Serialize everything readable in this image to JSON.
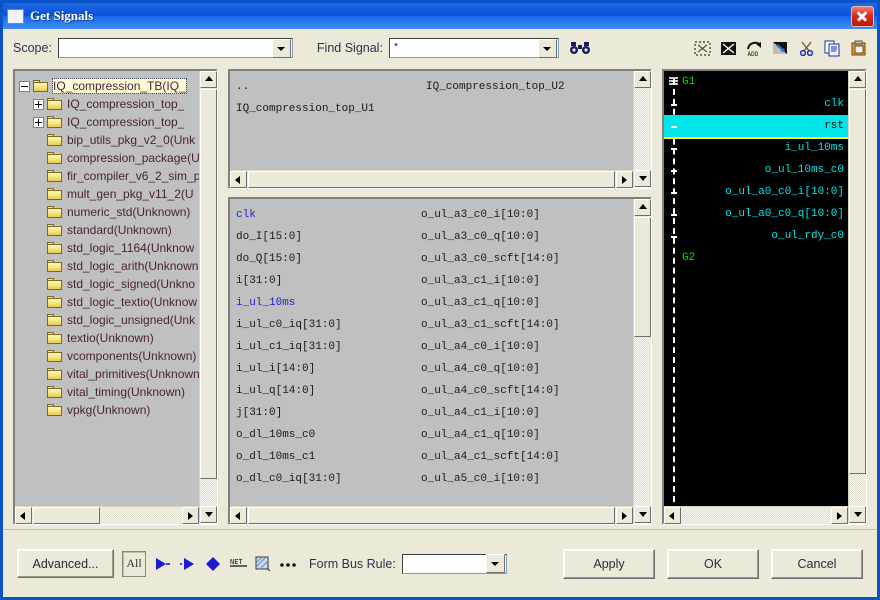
{
  "window": {
    "title": "Get Signals",
    "close_label": "Close",
    "icon": "window-icon"
  },
  "toolbar": {
    "scope_label": "Scope:",
    "scope_value": "",
    "scope_placeholder": "",
    "find_label": "Find Signal:",
    "find_value": "*",
    "find_button": "find-binoculars",
    "icons": [
      {
        "name": "select-none-icon",
        "title": "Select None"
      },
      {
        "name": "select-all-icon",
        "title": "Select All"
      },
      {
        "name": "add-icon",
        "title": "Add"
      },
      {
        "name": "replace-icon",
        "title": "Replace"
      },
      {
        "name": "cut-icon",
        "title": "Cut"
      },
      {
        "name": "copy-icon",
        "title": "Copy"
      },
      {
        "name": "paste-icon",
        "title": "Paste"
      }
    ]
  },
  "tree": {
    "items": [
      {
        "label": "IQ_compression_TB(IQ_",
        "depth": 0,
        "expander": "minus",
        "selected": true
      },
      {
        "label": "IQ_compression_top_",
        "depth": 1,
        "expander": "plus",
        "selected": false
      },
      {
        "label": "IQ_compression_top_",
        "depth": 1,
        "expander": "plus",
        "selected": false
      },
      {
        "label": "bip_utils_pkg_v2_0(Unk",
        "depth": 1,
        "expander": "none",
        "selected": false
      },
      {
        "label": "compression_package(U",
        "depth": 1,
        "expander": "none",
        "selected": false
      },
      {
        "label": "fir_compiler_v6_2_sim_p",
        "depth": 1,
        "expander": "none",
        "selected": false
      },
      {
        "label": "mult_gen_pkg_v11_2(U",
        "depth": 1,
        "expander": "none",
        "selected": false
      },
      {
        "label": "numeric_std(Unknown)",
        "depth": 1,
        "expander": "none",
        "selected": false
      },
      {
        "label": "standard(Unknown)",
        "depth": 1,
        "expander": "none",
        "selected": false
      },
      {
        "label": "std_logic_1164(Unknow",
        "depth": 1,
        "expander": "none",
        "selected": false
      },
      {
        "label": "std_logic_arith(Unknown",
        "depth": 1,
        "expander": "none",
        "selected": false
      },
      {
        "label": "std_logic_signed(Unkno",
        "depth": 1,
        "expander": "none",
        "selected": false
      },
      {
        "label": "std_logic_textio(Unknow",
        "depth": 1,
        "expander": "none",
        "selected": false
      },
      {
        "label": "std_logic_unsigned(Unk",
        "depth": 1,
        "expander": "none",
        "selected": false
      },
      {
        "label": "textio(Unknown)",
        "depth": 1,
        "expander": "none",
        "selected": false
      },
      {
        "label": "vcomponents(Unknown)",
        "depth": 1,
        "expander": "none",
        "selected": false
      },
      {
        "label": "vital_primitives(Unknown",
        "depth": 1,
        "expander": "none",
        "selected": false
      },
      {
        "label": "vital_timing(Unknown)",
        "depth": 1,
        "expander": "none",
        "selected": false
      },
      {
        "label": "vpkg(Unknown)",
        "depth": 1,
        "expander": "none",
        "selected": false
      }
    ]
  },
  "scope_list": {
    "col1": [
      "..",
      "IQ_compression_top_U1"
    ],
    "col2": [
      "IQ_compression_top_U2",
      ""
    ]
  },
  "signal_list": {
    "col1": [
      {
        "name": "clk",
        "highlight": true
      },
      {
        "name": "do_I[15:0]",
        "highlight": false
      },
      {
        "name": "do_Q[15:0]",
        "highlight": false
      },
      {
        "name": "i[31:0]",
        "highlight": false
      },
      {
        "name": "i_ul_10ms",
        "highlight": true
      },
      {
        "name": "i_ul_c0_iq[31:0]",
        "highlight": false
      },
      {
        "name": "i_ul_c1_iq[31:0]",
        "highlight": false
      },
      {
        "name": "i_ul_i[14:0]",
        "highlight": false
      },
      {
        "name": "i_ul_q[14:0]",
        "highlight": false
      },
      {
        "name": "j[31:0]",
        "highlight": false
      },
      {
        "name": "o_dl_10ms_c0",
        "highlight": false
      },
      {
        "name": "o_dl_10ms_c1",
        "highlight": false
      },
      {
        "name": "o_dl_c0_iq[31:0]",
        "highlight": false
      }
    ],
    "col2": [
      {
        "name": "o_ul_a3_c0_i[10:0]",
        "highlight": false
      },
      {
        "name": "o_ul_a3_c0_q[10:0]",
        "highlight": false
      },
      {
        "name": "o_ul_a3_c0_scft[14:0]",
        "highlight": false
      },
      {
        "name": "o_ul_a3_c1_i[10:0]",
        "highlight": false
      },
      {
        "name": "o_ul_a3_c1_q[10:0]",
        "highlight": false
      },
      {
        "name": "o_ul_a3_c1_scft[14:0]",
        "highlight": false
      },
      {
        "name": "o_ul_a4_c0_i[10:0]",
        "highlight": false
      },
      {
        "name": "o_ul_a4_c0_q[10:0]",
        "highlight": false
      },
      {
        "name": "o_ul_a4_c0_scft[14:0]",
        "highlight": false
      },
      {
        "name": "o_ul_a4_c1_i[10:0]",
        "highlight": false
      },
      {
        "name": "o_ul_a4_c1_q[10:0]",
        "highlight": false
      },
      {
        "name": "o_ul_a4_c1_scft[14:0]",
        "highlight": false
      },
      {
        "name": "o_ul_a5_c0_i[10:0]",
        "highlight": false
      }
    ]
  },
  "wave_panel": {
    "colors": {
      "group": "#00e000",
      "signal": "#00e5e5",
      "selected_bg": "#00e5e5",
      "selected_underline": "#ffff00",
      "background": "#000000"
    },
    "rows": [
      {
        "label": "G1",
        "type": "group",
        "selected": false
      },
      {
        "label": "clk",
        "type": "signal",
        "selected": false
      },
      {
        "label": "rst",
        "type": "signal",
        "selected": true
      },
      {
        "label": "i_ul_10ms",
        "type": "signal",
        "selected": false
      },
      {
        "label": "o_ul_10ms_c0",
        "type": "signal",
        "selected": false
      },
      {
        "label": "o_ul_a0_c0_i[10:0]",
        "type": "signal",
        "selected": false
      },
      {
        "label": "o_ul_a0_c0_q[10:0]",
        "type": "signal",
        "selected": false
      },
      {
        "label": "o_ul_rdy_c0",
        "type": "signal",
        "selected": false
      },
      {
        "label": "G2",
        "type": "group",
        "selected": false
      }
    ]
  },
  "bottom": {
    "advanced_label": "Advanced...",
    "all_label": "All",
    "filters": [
      {
        "name": "output-port-icon",
        "label": ""
      },
      {
        "name": "input-port-icon",
        "label": ""
      },
      {
        "name": "inout-port-icon",
        "label": ""
      },
      {
        "name": "net-icon",
        "label": "NET"
      },
      {
        "name": "variable-icon",
        "label": ""
      },
      {
        "name": "more-icon",
        "label": "..."
      }
    ],
    "form_bus_label": "Form Bus Rule:",
    "form_bus_value": "",
    "apply_label": "Apply",
    "ok_label": "OK",
    "cancel_label": "Cancel"
  }
}
